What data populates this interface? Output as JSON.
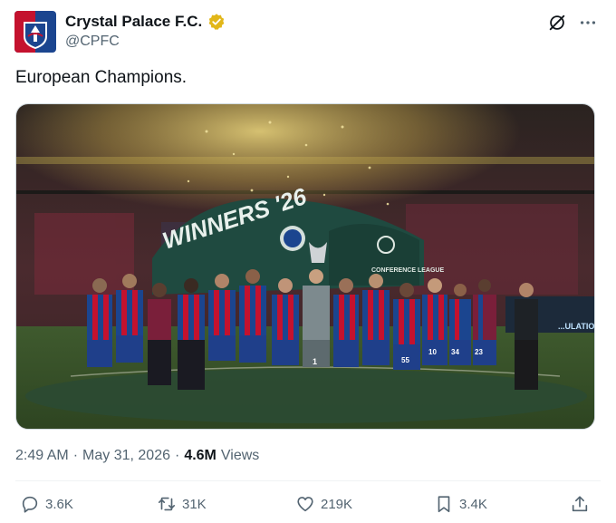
{
  "author": {
    "display_name": "Crystal Palace F.C.",
    "handle": "@CPFC",
    "verified": true,
    "verified_color": "#E2B719"
  },
  "tweet": {
    "text": "European Champions."
  },
  "media": {
    "banner_text": "WINNERS '26",
    "conference_text": "CONFERENCE LEAGUE",
    "board_text": "...ULATION",
    "players": [
      {
        "number": "1"
      },
      {
        "number": "10"
      },
      {
        "number": "34"
      },
      {
        "number": "23"
      },
      {
        "number": "55"
      }
    ]
  },
  "meta": {
    "time": "2:49 AM",
    "separator": "·",
    "date": "May 31, 2026",
    "views_count": "4.6M",
    "views_label": "Views"
  },
  "actions": {
    "replies": "3.6K",
    "reposts": "31K",
    "likes": "219K",
    "bookmarks": "3.4K"
  },
  "colors": {
    "text_primary": "#0f1419",
    "text_secondary": "#536471",
    "palace_blue": "#1B458F",
    "palace_red": "#C4122E"
  },
  "icons": {
    "grok": "grok-icon",
    "more": "more-icon",
    "reply": "reply-icon",
    "repost": "repost-icon",
    "like": "heart-icon",
    "bookmark": "bookmark-icon",
    "share": "share-icon"
  }
}
